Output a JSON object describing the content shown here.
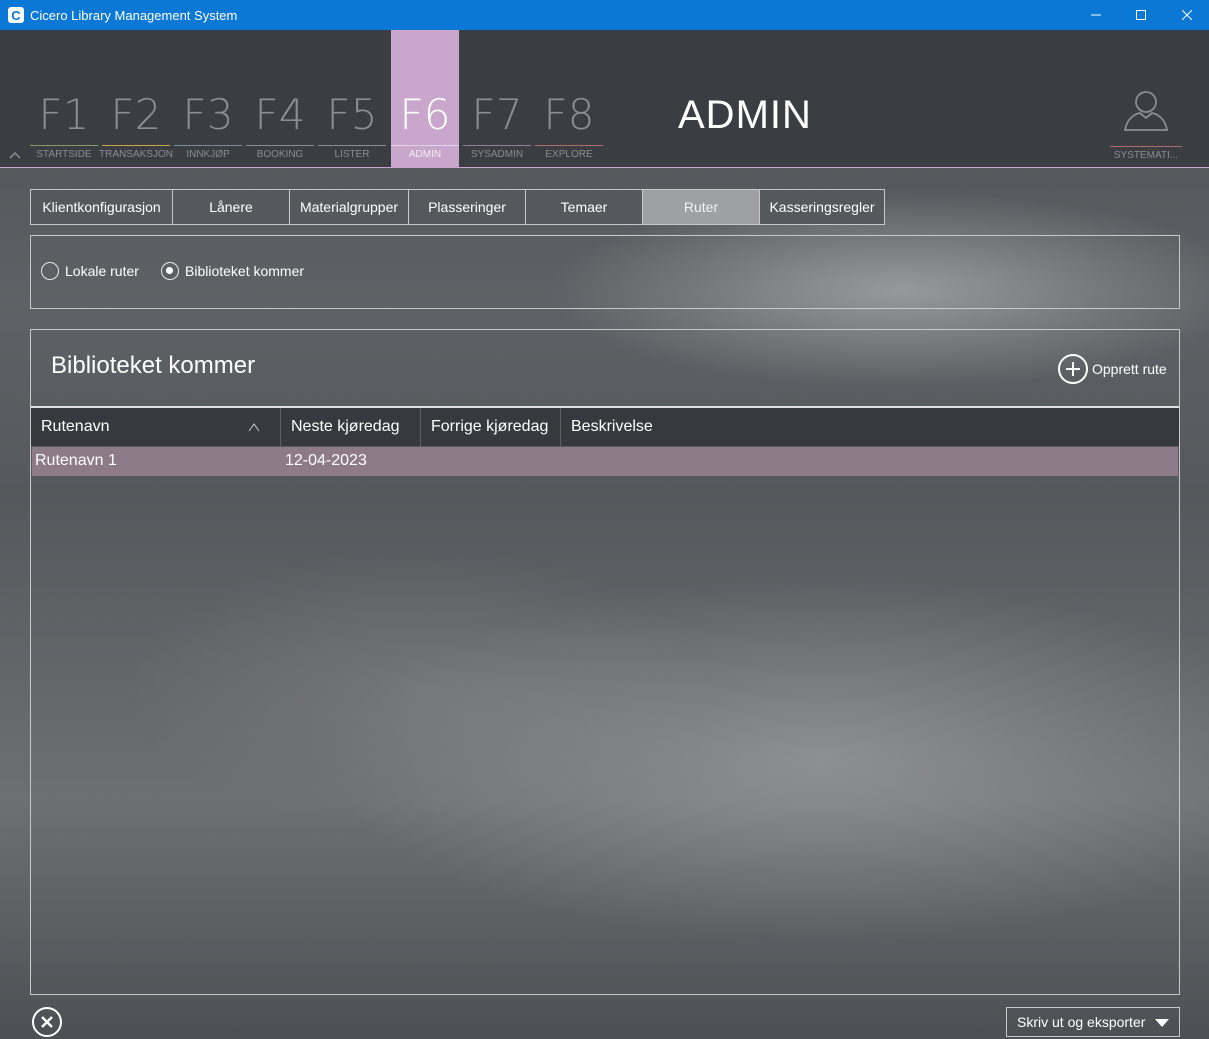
{
  "window": {
    "title": "Cicero Library Management System",
    "icon_letter": "C",
    "controls": [
      "minimize",
      "maximize",
      "close"
    ]
  },
  "nav": {
    "fkeys": [
      {
        "key": "F1",
        "label": "STARTSIDE",
        "line_color": "#8a9a6a"
      },
      {
        "key": "F2",
        "label": "TRANSAKSJON",
        "line_color": "#c7a44a"
      },
      {
        "key": "F3",
        "label": "INNKJØP",
        "line_color": "#7a8a9a"
      },
      {
        "key": "F4",
        "label": "BOOKING",
        "line_color": "#8a8d91"
      },
      {
        "key": "F5",
        "label": "LISTER",
        "line_color": "#8a8d91"
      },
      {
        "key": "F6",
        "label": "ADMIN",
        "line_color": "#c9a6cc",
        "active": true
      },
      {
        "key": "F7",
        "label": "SYSADMIN",
        "line_color": "#9a7a9a"
      },
      {
        "key": "F8",
        "label": "EXPLORE",
        "line_color": "#b36a6a"
      }
    ],
    "section_title": "ADMIN",
    "user_label": "SYSTEMATI..."
  },
  "tabs": [
    {
      "label": "Klientkonfigurasjon"
    },
    {
      "label": "Lånere"
    },
    {
      "label": "Materialgrupper"
    },
    {
      "label": "Plasseringer"
    },
    {
      "label": "Temaer"
    },
    {
      "label": "Ruter",
      "selected": true
    },
    {
      "label": "Kasseringsregler"
    }
  ],
  "route_type": {
    "options": [
      {
        "label": "Lokale ruter",
        "checked": false
      },
      {
        "label": "Biblioteket kommer",
        "checked": true
      }
    ]
  },
  "panel": {
    "title": "Biblioteket kommer",
    "create_label": "Opprett rute",
    "columns": [
      "Rutenavn",
      "Neste kjøredag",
      "Forrige kjøredag",
      "Beskrivelse"
    ],
    "sort": {
      "column": "Rutenavn",
      "direction": "ascending"
    },
    "rows": [
      {
        "name": "Rutenavn 1",
        "next": "12-04-2023",
        "previous": "",
        "description": ""
      }
    ]
  },
  "footer": {
    "export_label": "Skriv ut og eksporter"
  },
  "colors": {
    "titlebar": "#0a78d4",
    "accent": "#c9a6cc",
    "selected_row": "#8d7b89"
  }
}
